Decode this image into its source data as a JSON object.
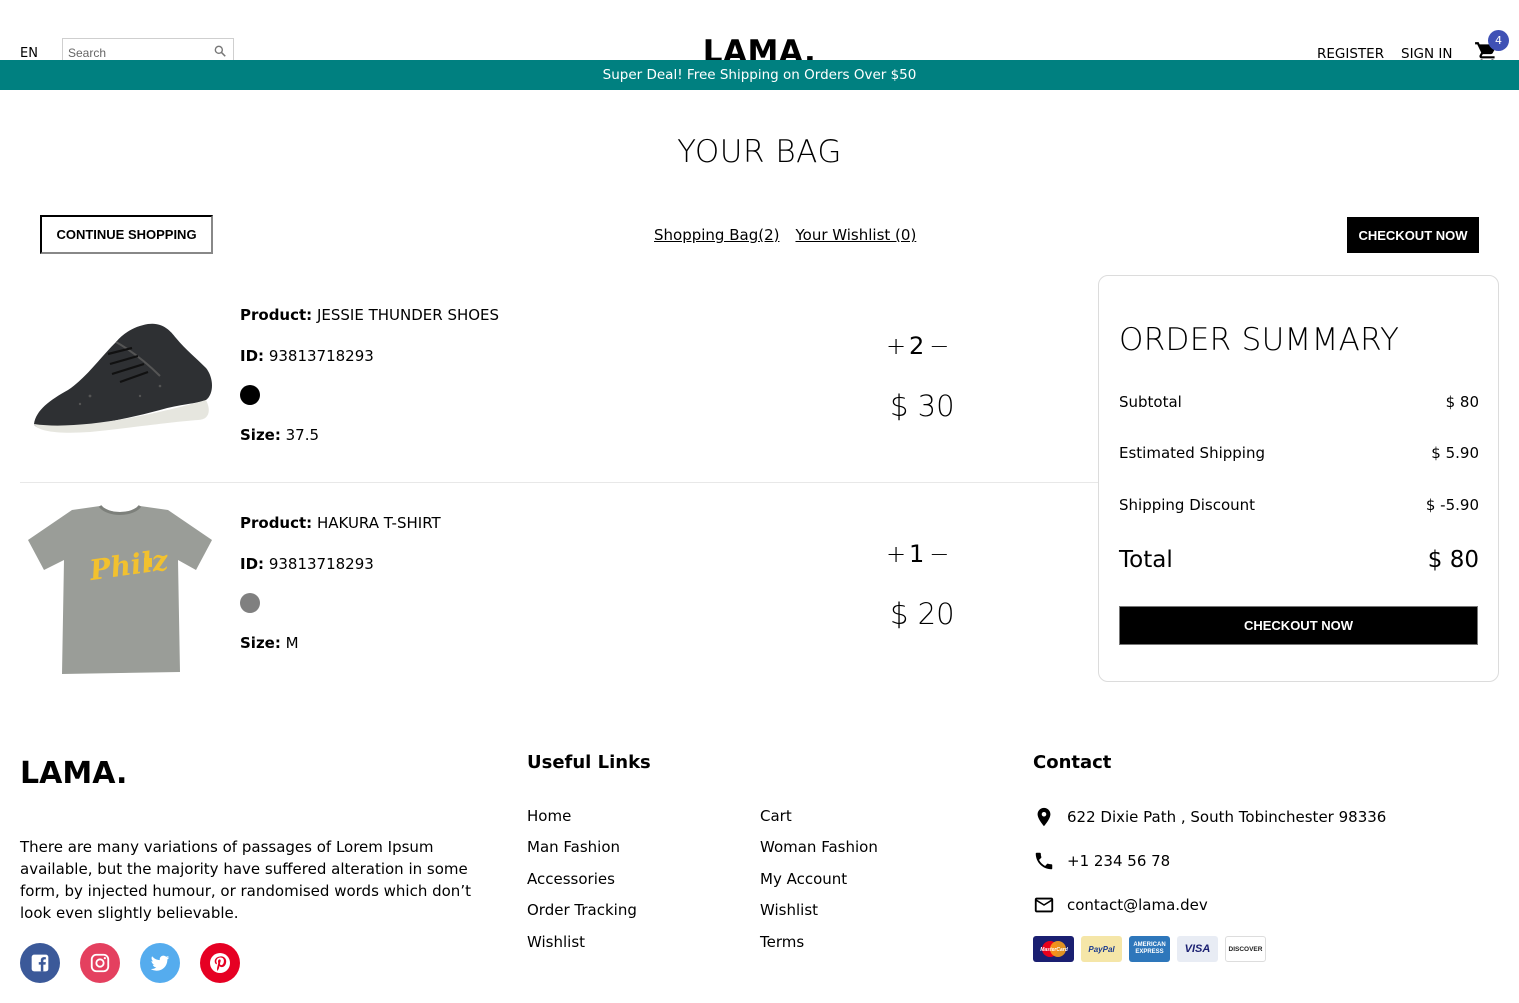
{
  "navbar": {
    "language": "EN",
    "search_placeholder": "Search",
    "logo": "LAMA.",
    "register": "REGISTER",
    "sign_in": "SIGN IN",
    "cart_count": "4"
  },
  "announcement": "Super Deal! Free Shipping on Orders Over $50",
  "page": {
    "title": "YOUR BAG",
    "continue_shopping": "CONTINUE SHOPPING",
    "shopping_bag": "Shopping Bag(2)",
    "wishlist": "Your Wishlist (0)",
    "checkout_now": "CHECKOUT NOW"
  },
  "products": [
    {
      "product_label": "Product:",
      "name": "JESSIE THUNDER SHOES",
      "id_label": "ID:",
      "id": "93813718293",
      "color": "#000000",
      "size_label": "Size:",
      "size": "37.5",
      "plus": "+",
      "quantity": "2",
      "minus": "−",
      "price": "$ 30",
      "image": "shoe-image"
    },
    {
      "product_label": "Product:",
      "name": "HAKURA T-SHIRT",
      "id_label": "ID:",
      "id": "93813718293",
      "color": "#808080",
      "size_label": "Size:",
      "size": "M",
      "plus": "+",
      "quantity": "1",
      "minus": "−",
      "price": "$ 20",
      "image": "tshirt-image",
      "shirt_print": "Philz"
    }
  ],
  "summary": {
    "title": "ORDER SUMMARY",
    "subtotal_label": "Subtotal",
    "subtotal": "$ 80",
    "shipping_label": "Estimated Shipping",
    "shipping": "$ 5.90",
    "discount_label": "Shipping Discount",
    "discount": "$ -5.90",
    "total_label": "Total",
    "total": "$ 80",
    "checkout": "CHECKOUT NOW"
  },
  "footer": {
    "logo": "LAMA.",
    "description": "There are many variations of passages of Lorem Ipsum available, but the majority have suffered alteration in some form, by injected humour, or randomised words which don’t look even slightly believable.",
    "socials": [
      "facebook-icon",
      "instagram-icon",
      "twitter-icon",
      "pinterest-icon"
    ],
    "links_title": "Useful Links",
    "links_col1": [
      "Home",
      "Man Fashion",
      "Accessories",
      "Order Tracking",
      "Wishlist"
    ],
    "links_col2": [
      "Cart",
      "Woman Fashion",
      "My Account",
      "Wishlist",
      "Terms"
    ],
    "contact_title": "Contact",
    "address": "622 Dixie Path , South Tobinchester 98336",
    "phone": "+1 234 56 78",
    "email": "contact@lama.dev",
    "payments": [
      "MasterCard",
      "PayPal",
      "AMERICAN EXPRESS",
      "VISA",
      "DISCOVER"
    ]
  },
  "colors": {
    "announcement_bg": "#008080",
    "badge": "#3f51b5",
    "facebook": "#3b5999",
    "instagram": "#e4405f",
    "twitter": "#55acee",
    "pinterest": "#e60023"
  }
}
